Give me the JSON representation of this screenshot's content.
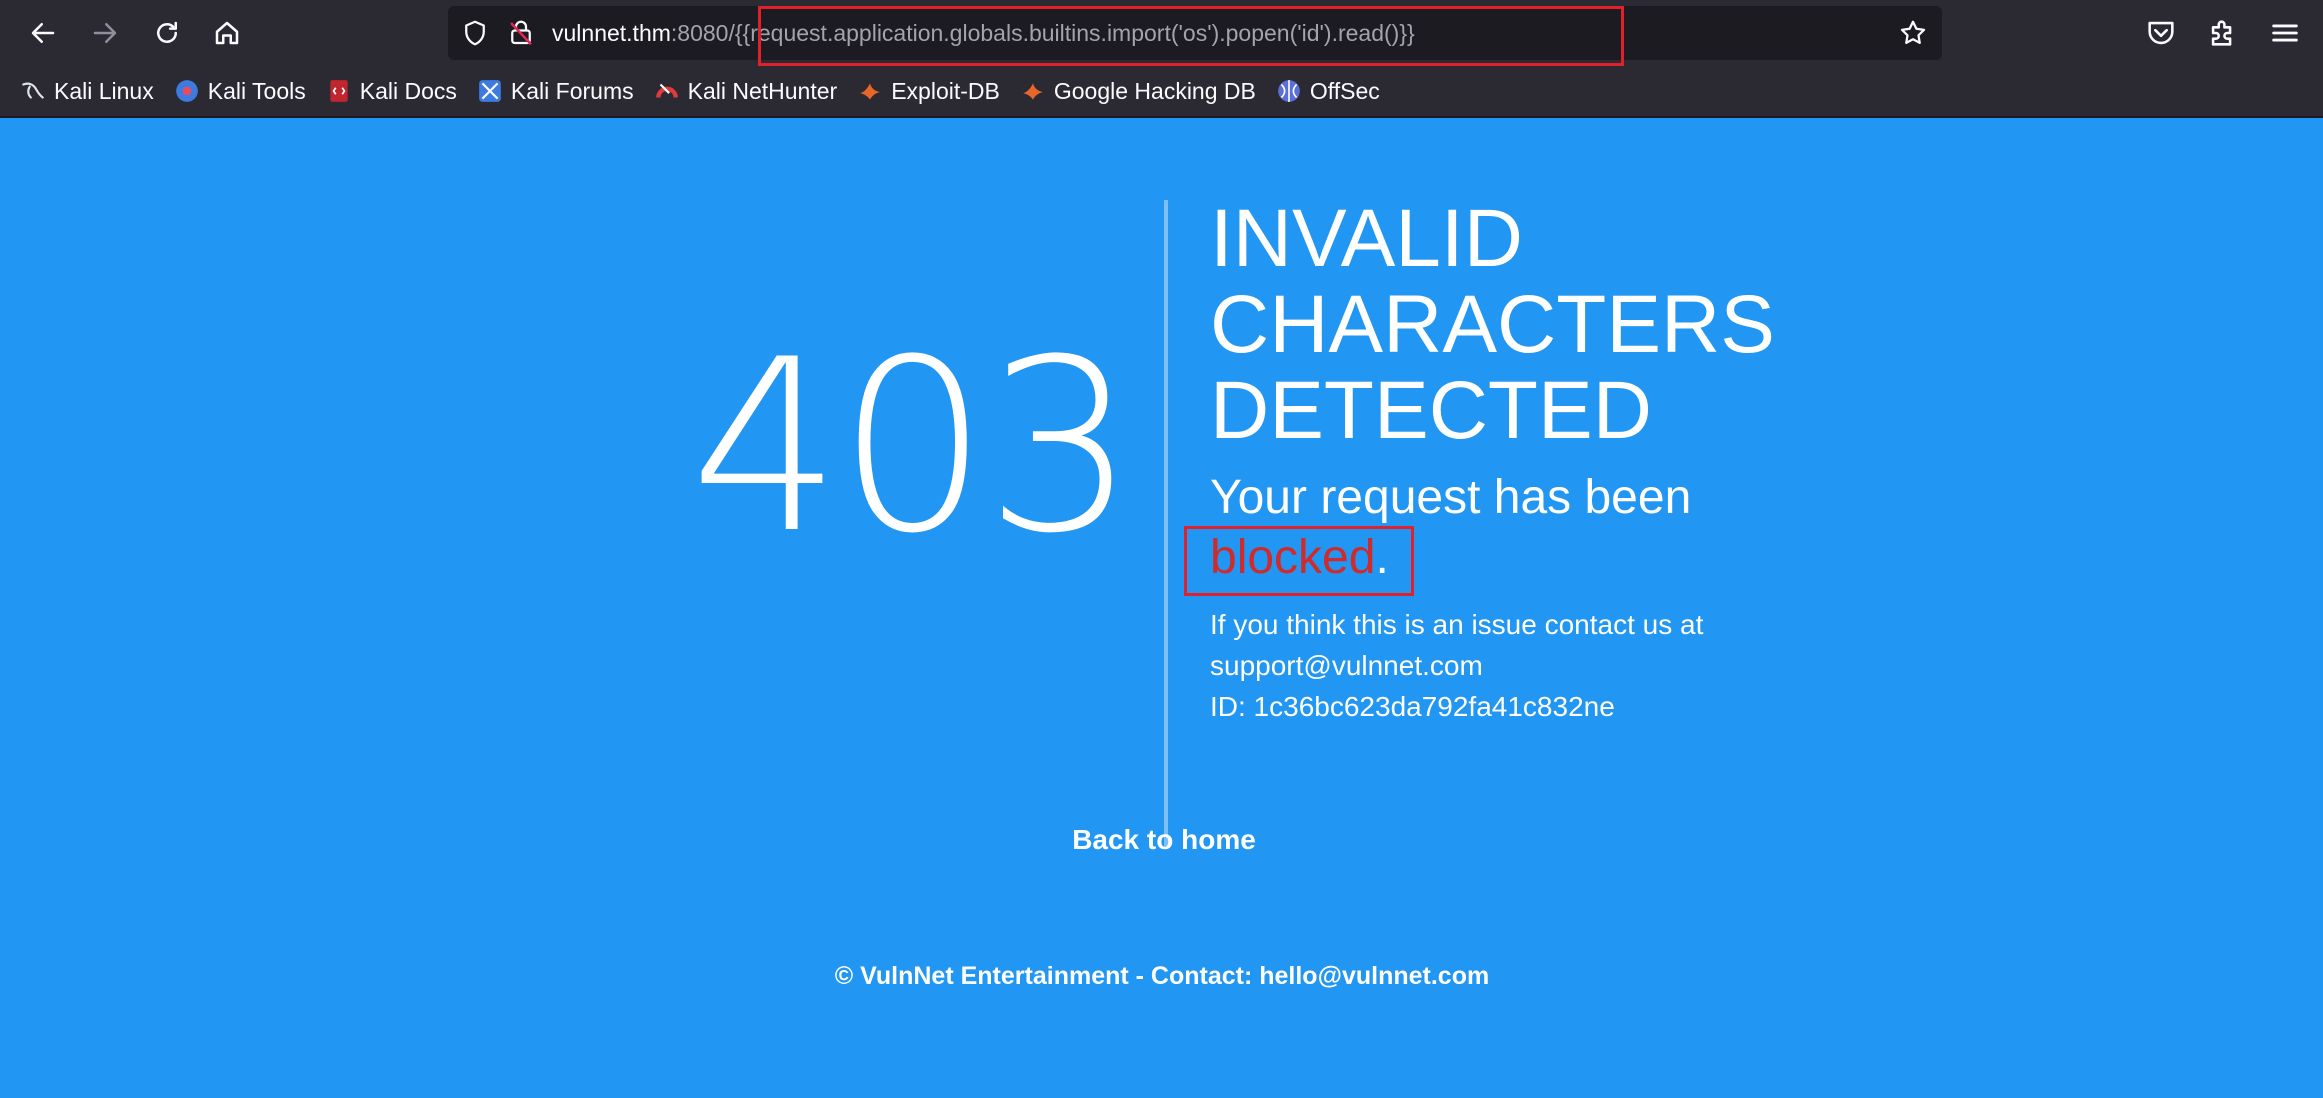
{
  "browser": {
    "url": {
      "host": "vulnnet.thm",
      "port": ":8080/",
      "path": "{{request.application.globals.builtins.import('os').popen('id').read()}}"
    },
    "icons": {
      "back": "arrow-left-icon",
      "forward": "arrow-right-icon",
      "reload": "reload-icon",
      "home": "home-icon",
      "shield": "shield-icon",
      "lock": "lock-icon",
      "star": "star-icon",
      "pocket": "pocket-icon",
      "extensions": "puzzle-icon",
      "menu": "hamburger-menu-icon"
    },
    "bookmarks": [
      {
        "label": "Kali Linux",
        "icon": "kali-dragon-icon"
      },
      {
        "label": "Kali Tools",
        "icon": "kali-tools-icon"
      },
      {
        "label": "Kali Docs",
        "icon": "kali-docs-icon"
      },
      {
        "label": "Kali Forums",
        "icon": "kali-forums-icon"
      },
      {
        "label": "Kali NetHunter",
        "icon": "kali-nethunter-icon"
      },
      {
        "label": "Exploit-DB",
        "icon": "exploit-db-icon"
      },
      {
        "label": "Google Hacking DB",
        "icon": "ghdb-icon"
      },
      {
        "label": "OffSec",
        "icon": "offsec-icon"
      }
    ]
  },
  "page": {
    "code": "403",
    "heading_lines": [
      "INVALID",
      "CHARACTERS",
      "DETECTED"
    ],
    "lead_prefix": "Your request has been",
    "lead_blocked": "blocked",
    "lead_suffix": ".",
    "info_lines": [
      "If you think this is an issue contact us at",
      "support@vulnnet.com",
      "ID: 1c36bc623da792fa41c832ne"
    ],
    "back_link": "Back to home",
    "footer": "© VulnNet Entertainment - Contact: hello@vulnnet.com"
  },
  "colors": {
    "page_background": "#2196f3",
    "blocked_text": "#d02a2a",
    "annotation_box": "#e0202a",
    "toolbar": "#2b2a33"
  }
}
